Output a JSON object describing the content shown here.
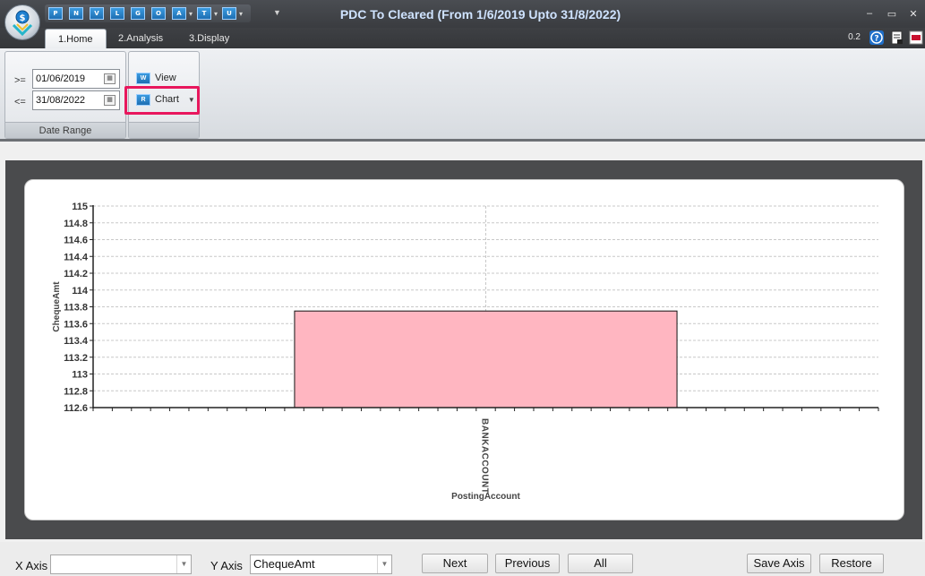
{
  "window": {
    "title": "PDC To Cleared (From 1/6/2019 Upto 31/8/2022)",
    "minimize_glyph": "–",
    "restore_glyph": "▭",
    "close_glyph": "✕"
  },
  "quick_access": [
    {
      "letter": "P",
      "has_dropdown": false
    },
    {
      "letter": "N",
      "has_dropdown": false
    },
    {
      "letter": "V",
      "has_dropdown": false
    },
    {
      "letter": "L",
      "has_dropdown": false
    },
    {
      "letter": "G",
      "has_dropdown": false
    },
    {
      "letter": "O",
      "has_dropdown": false
    },
    {
      "letter": "A",
      "has_dropdown": true
    },
    {
      "letter": "T",
      "has_dropdown": true
    },
    {
      "letter": "U",
      "has_dropdown": true
    }
  ],
  "tabs": [
    "1.Home",
    "2.Analysis",
    "3.Display"
  ],
  "version": "0.2",
  "date_range": {
    "caption": "Date Range",
    "from_op": ">=",
    "from_value": "01/06/2019",
    "to_op": "<=",
    "to_value": "31/08/2022"
  },
  "actions": {
    "view_label": "View",
    "view_icon": "W",
    "chart_label": "Chart",
    "chart_icon": "R"
  },
  "chart_data": {
    "type": "bar",
    "categories": [
      "BANKACCOUNT"
    ],
    "values": [
      113.75
    ],
    "xlabel": "PostingAccount",
    "ylabel": "ChequeAmt",
    "ylim": [
      112.6,
      115
    ],
    "yticks": [
      "115",
      "114.8",
      "114.6",
      "114.4",
      "114.2",
      "114",
      "113.8",
      "113.6",
      "113.4",
      "113.2",
      "113",
      "112.8",
      "112.6"
    ],
    "bar_color": "#ffb6c1",
    "grid": true
  },
  "bottom": {
    "x_axis_label": "X Axis",
    "x_axis_value": "",
    "y_axis_label": "Y Axis",
    "y_axis_value": "ChequeAmt",
    "next_label": "Next",
    "previous_label": "Previous",
    "all_label": "All",
    "save_axis_label": "Save Axis",
    "restore_label": "Restore"
  }
}
